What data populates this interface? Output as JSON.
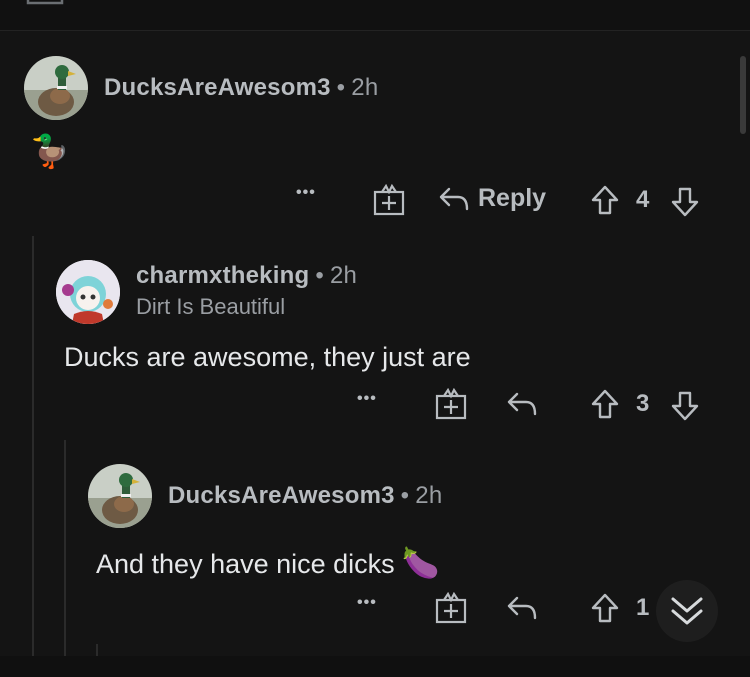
{
  "comments": [
    {
      "username": "DucksAreAwesom3",
      "time": "2h",
      "body_emoji": "🦆",
      "reply_label": "Reply",
      "votes": "4"
    },
    {
      "username": "charmxtheking",
      "time": "2h",
      "flair": "Dirt Is Beautiful",
      "body": "Ducks are awesome, they just are",
      "votes": "3"
    },
    {
      "username": "DucksAreAwesom3",
      "time": "2h",
      "body": "And they have nice dicks",
      "body_emoji": "🍆",
      "votes": "1"
    }
  ],
  "separator": "•",
  "more_label": "•••",
  "colors": {
    "background": "#141414",
    "text": "#d7dadc",
    "muted": "#9a9ea3"
  },
  "icons": [
    "monitor-icon",
    "more-icon",
    "award-icon",
    "reply-icon",
    "upvote-icon",
    "downvote-icon",
    "collapse-chevron-icon"
  ]
}
